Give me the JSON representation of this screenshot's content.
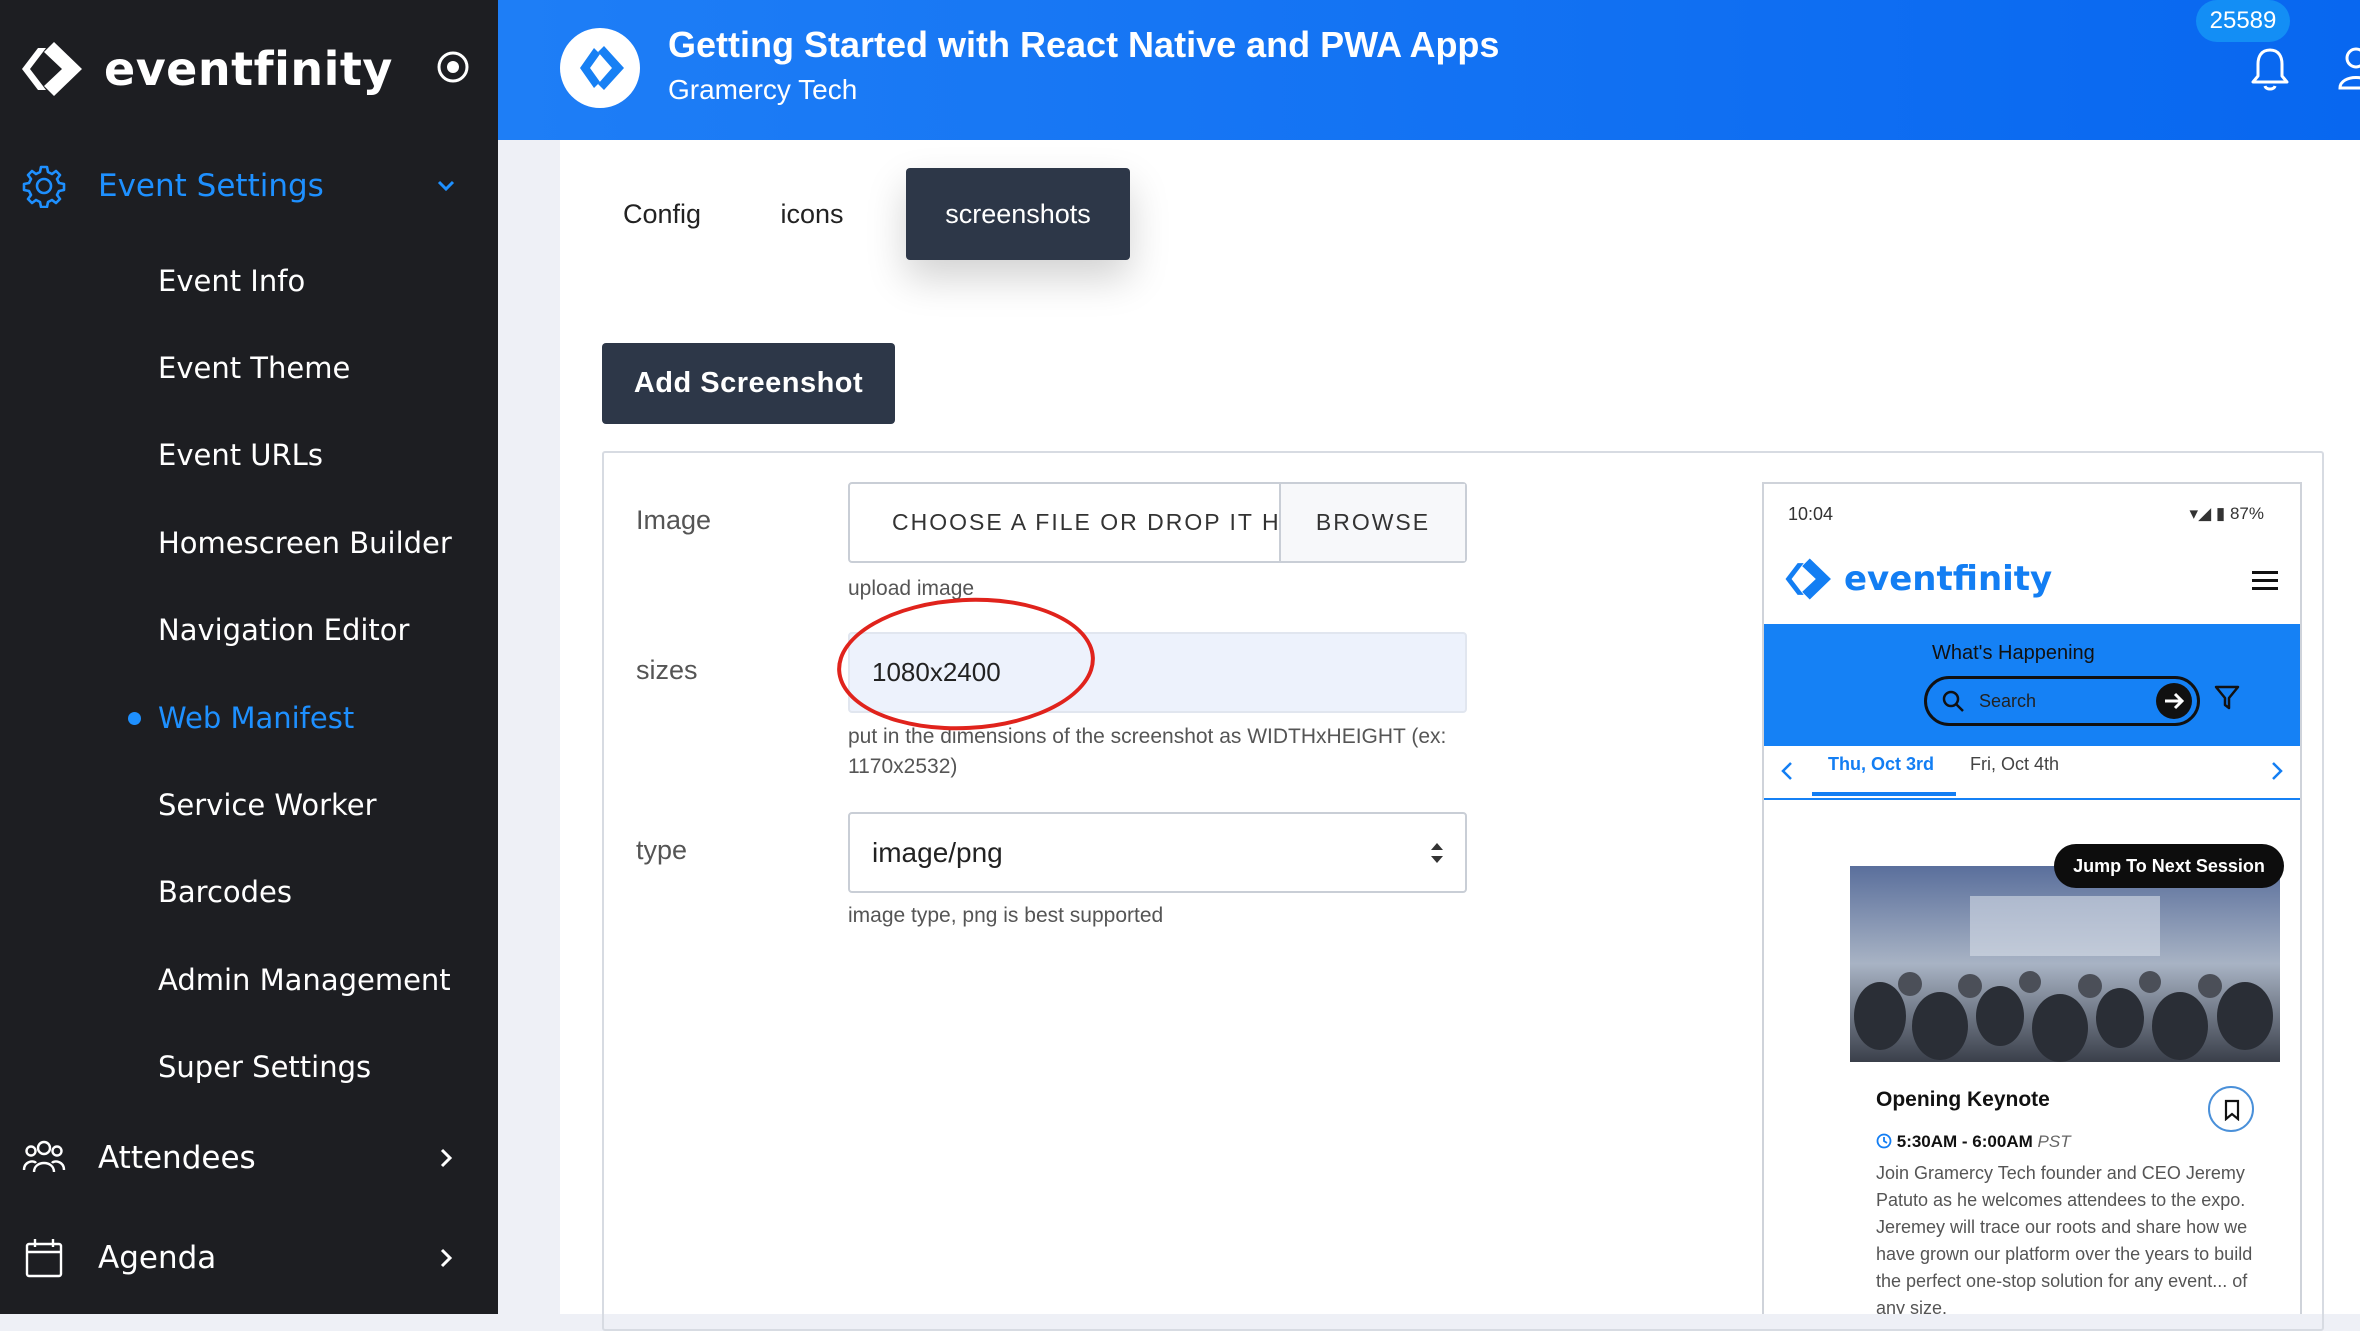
{
  "sidebar": {
    "logo_text": "eventfinity",
    "section_event_settings": "Event Settings",
    "items": [
      {
        "label": "Event Info"
      },
      {
        "label": "Event Theme"
      },
      {
        "label": "Event URLs"
      },
      {
        "label": "Homescreen Builder"
      },
      {
        "label": "Navigation Editor"
      },
      {
        "label": "Web Manifest",
        "active": true
      },
      {
        "label": "Service Worker"
      },
      {
        "label": "Barcodes"
      },
      {
        "label": "Admin Management"
      },
      {
        "label": "Super Settings"
      }
    ],
    "section_attendees": "Attendees",
    "section_agenda": "Agenda",
    "accent_color": "#1e90ff"
  },
  "header": {
    "title": "Getting Started with React Native and PWA Apps",
    "subtitle": "Gramercy Tech",
    "notification_count": "25589"
  },
  "tabs": [
    {
      "label": "Config"
    },
    {
      "label": "icons"
    },
    {
      "label": "screenshots",
      "active": true
    }
  ],
  "actions": {
    "add_screenshot": "Add Screenshot"
  },
  "form": {
    "image": {
      "label": "Image",
      "placeholder": "CHOOSE A FILE OR DROP IT HERE...",
      "browse": "BROWSE",
      "help": "upload image"
    },
    "sizes": {
      "label": "sizes",
      "value": "1080x2400",
      "help_line1": "put in the dimensions of the screenshot as WIDTHxHEIGHT (ex:",
      "help_line2": "1170x2532)"
    },
    "type": {
      "label": "type",
      "value": "image/png",
      "help": "image type, png is best supported"
    }
  },
  "phone_preview": {
    "status_time": "10:04",
    "status_battery": "87%",
    "logo_text": "eventfinity",
    "whats_happening": "What's Happening",
    "search_placeholder": "Search",
    "date_active": "Thu, Oct 3rd",
    "date_next": "Fri, Oct 4th",
    "jump_button": "Jump To Next Session",
    "session_title": "Opening Keynote",
    "session_time": "5:30AM - 6:00AM",
    "session_tz": "PST",
    "session_desc": "Join Gramercy Tech founder and CEO Jeremy Patuto as he welcomes attendees to the expo. Jeremey will trace our roots and share how we have grown our platform over the years to build the perfect one-stop solution for any event... of any size."
  }
}
